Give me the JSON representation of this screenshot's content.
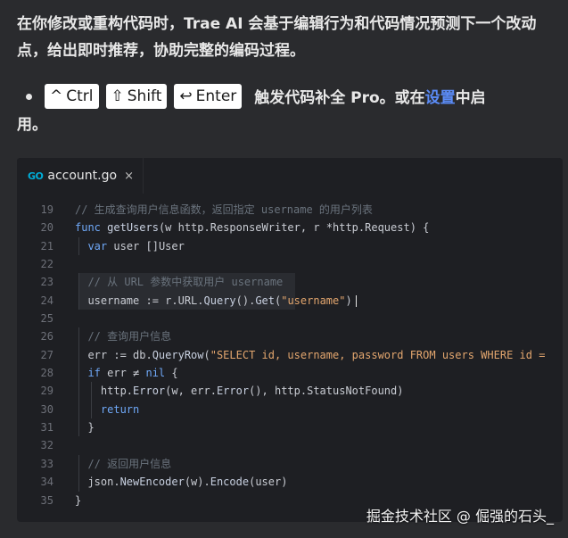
{
  "intro": {
    "text": "在你修改或重构代码时，Trae AI 会基于编辑行为和代码情况预测下一个改动点，给出即时推荐，协助完整的编码过程。"
  },
  "shortcut": {
    "keys": [
      {
        "icon": "^",
        "label": "Ctrl"
      },
      {
        "icon": "⇧",
        "label": "Shift"
      },
      {
        "icon": "↩",
        "label": "Enter"
      }
    ],
    "text_before_link": "触发代码补全 Pro。或在",
    "link_label": "设置",
    "text_after_link": "中启",
    "continuation": "用。"
  },
  "editor": {
    "tab": {
      "icon": "go",
      "filename": "account.go",
      "close": "×"
    },
    "lines": [
      {
        "num": "19",
        "text": "// 生成查询用户信息函数，返回指定 username 的用户列表"
      },
      {
        "num": "20",
        "text": "func getUsers(w http.ResponseWriter, r *http.Request) {"
      },
      {
        "num": "21",
        "text": "  var user []User"
      },
      {
        "num": "22",
        "text": ""
      },
      {
        "num": "23",
        "text": "  // 从 URL 参数中获取用户 username"
      },
      {
        "num": "24",
        "text": "  username := r.URL.Query().Get(\"username\")"
      },
      {
        "num": "25",
        "text": ""
      },
      {
        "num": "26",
        "text": "  // 查询用户信息"
      },
      {
        "num": "27",
        "text": "  err := db.QueryRow(\"SELECT id, username, password FROM users WHERE id ="
      },
      {
        "num": "28",
        "text": "  if err ≠ nil {"
      },
      {
        "num": "29",
        "text": "    http.Error(w, err.Error(), http.StatusNotFound)"
      },
      {
        "num": "30",
        "text": "    return"
      },
      {
        "num": "31",
        "text": "  }"
      },
      {
        "num": "32",
        "text": ""
      },
      {
        "num": "33",
        "text": "  // 返回用户信息"
      },
      {
        "num": "34",
        "text": "  json.NewEncoder(w).Encode(user)"
      },
      {
        "num": "35",
        "text": "}"
      }
    ]
  },
  "watermark": "掘金技术社区 @ 倔强的石头_",
  "colors": {
    "background": "#2a2b2e",
    "editor_bg": "#1e1f23",
    "link": "#5b8cf7",
    "keyword": "#6fa8f7",
    "string": "#e3a66e",
    "comment": "#6a737d"
  }
}
